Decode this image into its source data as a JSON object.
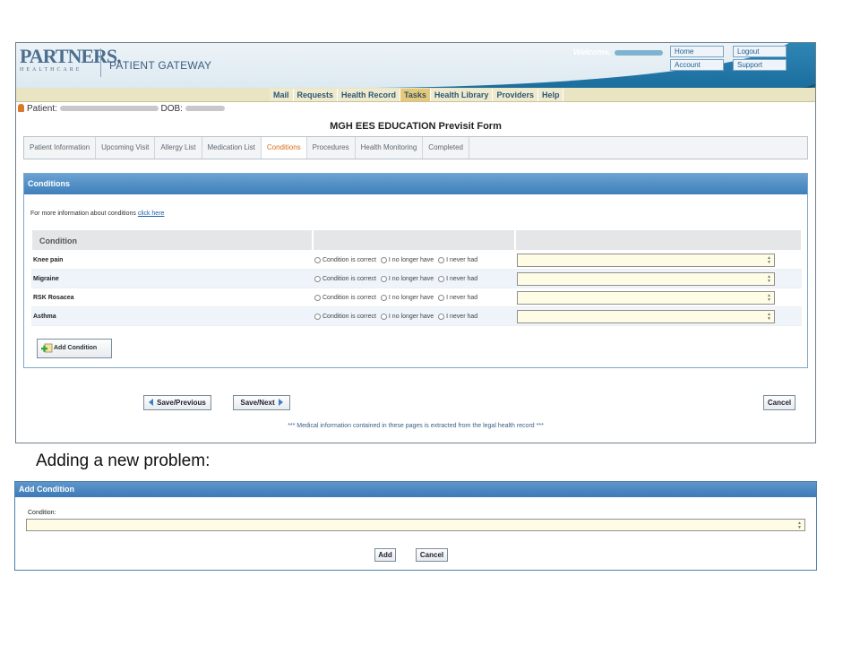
{
  "header": {
    "logo_text": "PARTNERS.",
    "logo_sub": "HEALTHCARE",
    "app_title": "PATIENT GATEWAY",
    "welcome": "Welcome,",
    "buttons": {
      "home": "Home",
      "logout": "Logout",
      "account": "Account",
      "support": "Support"
    }
  },
  "nav": {
    "items": [
      "Mail",
      "Requests",
      "Health Record",
      "Tasks",
      "Health Library",
      "Providers",
      "Help"
    ],
    "active": "Tasks"
  },
  "patient": {
    "label": "Patient:",
    "dob_label": "DOB:"
  },
  "form_title": "MGH EES EDUCATION Previsit Form",
  "tabs": [
    "Patient Information",
    "Upcoming Visit",
    "Allergy List",
    "Medication List",
    "Conditions",
    "Procedures",
    "Health Monitoring",
    "Completed"
  ],
  "active_tab": "Conditions",
  "conditions_panel": {
    "title": "Conditions",
    "info_text": "For more information about conditions",
    "info_link": "click here",
    "column_header": "Condition",
    "radio_labels": [
      "Condition is correct",
      "I no longer have",
      "I never had"
    ],
    "rows": [
      "Knee pain",
      "Migraine",
      "RSK Rosacea",
      "Asthma"
    ],
    "add_button": "Add Condition"
  },
  "actions": {
    "save_previous": "Save/Previous",
    "save_next": "Save/Next",
    "cancel": "Cancel"
  },
  "footer_note": "*** Medical information contained in these pages is extracted from the legal health record ***",
  "caption": "Adding a new problem:",
  "dialog": {
    "title": "Add Condition",
    "field_label": "Condition:",
    "add": "Add",
    "cancel": "Cancel"
  },
  "colors": {
    "header_blue": "#1b6e9d",
    "nav_bg": "#e9e4c2",
    "panel_head": "#3f7fba",
    "active_tab": "#d96d1c",
    "field_bg": "#fffce5"
  }
}
